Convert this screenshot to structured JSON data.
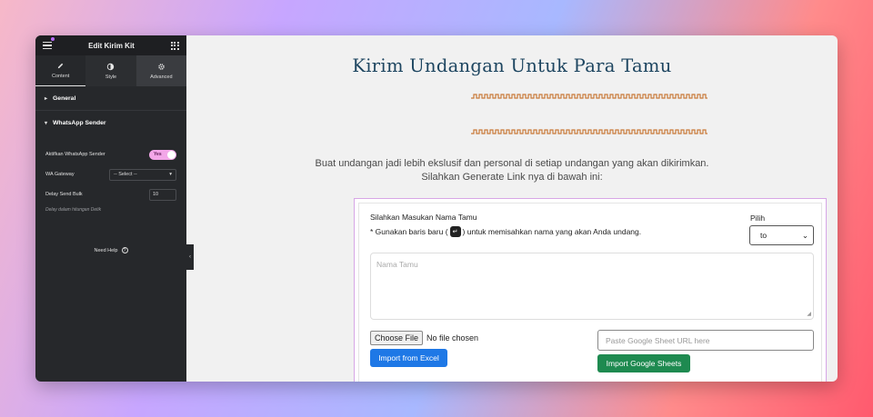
{
  "sidebar": {
    "title": "Edit Kirim Kit",
    "tabs": [
      {
        "label": "Content",
        "icon": "pencil-icon"
      },
      {
        "label": "Style",
        "icon": "half-circle-icon"
      },
      {
        "label": "Advanced",
        "icon": "gear-icon"
      }
    ],
    "sections": {
      "general": "General",
      "whatsapp": "WhatsApp Sender"
    },
    "controls": {
      "activate_label": "Aktifkan WhatsApp Sender",
      "activate_value": "Yes",
      "gateway_label": "WA Gateway",
      "gateway_value": "-- Select --",
      "delay_label": "Delay Send Bulk",
      "delay_value": "10",
      "delay_hint": "Delay dalam hitungan Detik"
    },
    "need_help": "Need Help"
  },
  "main": {
    "headline": "Kirim Undangan Untuk Para Tamu",
    "desc_line1": "Buat undangan jadi lebih ekslusif dan personal di setiap undangan yang akan dikirimkan.",
    "desc_line2": "Silahkan Generate Link nya di bawah ini:",
    "accent_color": "#c97a3a"
  },
  "form": {
    "name_label": "Silahkan Masukan Nama Tamu",
    "note_prefix": "* Gunakan baris baru (",
    "note_suffix": ") untuk memisahkan nama yang akan Anda undang.",
    "pilih_label": "Pilih",
    "pilih_value": "to",
    "textarea_placeholder": "Nama Tamu",
    "choose_file": "Choose File",
    "no_file": "No file chosen",
    "import_excel": "Import from Excel",
    "sheet_placeholder": "Paste Google Sheet URL here",
    "import_sheets": "Import Google Sheets"
  }
}
